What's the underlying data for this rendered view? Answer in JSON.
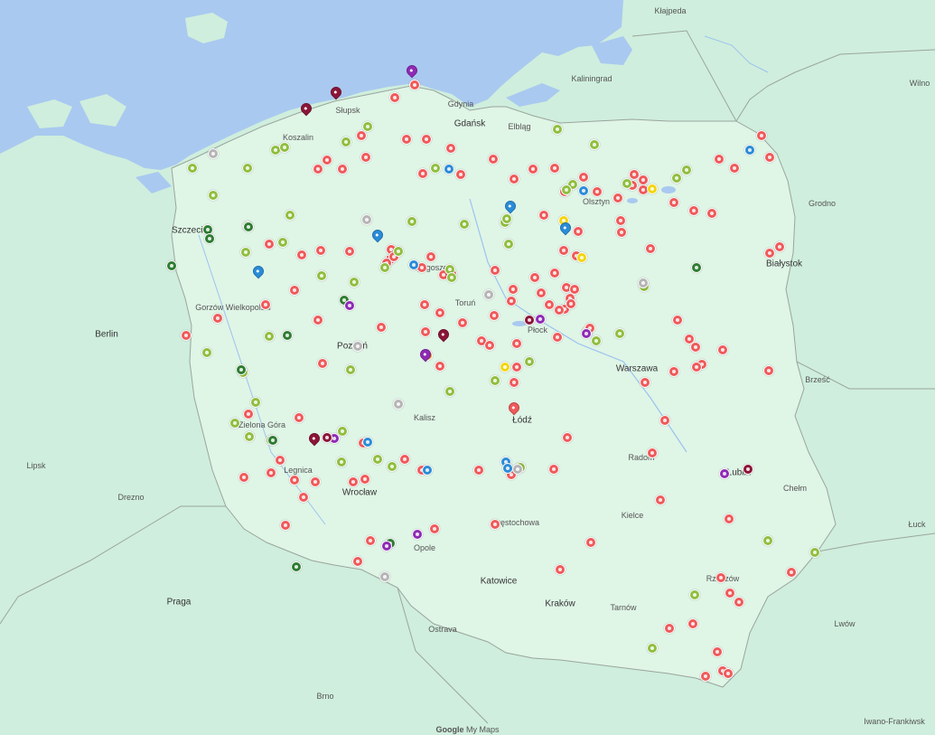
{
  "map": {
    "attribution_brand": "Google",
    "attribution_product": "My Maps",
    "colors": {
      "land": "#cfeedd",
      "land_pl": "#dff5e6",
      "sea": "#a9c9f0",
      "border": "#9aa59c",
      "red": "#ef5a5a",
      "lime": "#8fbf3f",
      "darkgreen": "#2e7d32",
      "blue": "#2a8cd8",
      "gray": "#b5b5b5",
      "yellow": "#f2d60f",
      "purple": "#8e2bb5",
      "maroon": "#8b1538",
      "orange": "#f08c1c"
    }
  },
  "cities": [
    {
      "name": "Gdańsk",
      "big": true
    },
    {
      "name": "Gdynia",
      "big": false
    },
    {
      "name": "Szczecin",
      "big": true
    },
    {
      "name": "Poznań",
      "big": true
    },
    {
      "name": "Warszawa",
      "big": true
    },
    {
      "name": "Łódź",
      "big": true
    },
    {
      "name": "Wrocław",
      "big": true
    },
    {
      "name": "Kraków",
      "big": true
    },
    {
      "name": "Katowice",
      "big": true
    },
    {
      "name": "Lublin",
      "big": true
    },
    {
      "name": "Białystok",
      "big": true
    },
    {
      "name": "Bydgoszcz",
      "big": false
    },
    {
      "name": "Berlin",
      "big": true
    },
    {
      "name": "Praga",
      "big": true
    },
    {
      "name": "Drezno",
      "big": false
    },
    {
      "name": "Lipsk",
      "big": false
    },
    {
      "name": "Wilno",
      "big": false
    },
    {
      "name": "Lwów",
      "big": false
    },
    {
      "name": "Ostrava",
      "big": false
    },
    {
      "name": "Brno",
      "big": false
    },
    {
      "name": "Olsztyn",
      "big": false
    },
    {
      "name": "Kielce",
      "big": false
    },
    {
      "name": "Radom",
      "big": false
    },
    {
      "name": "Rzeszów",
      "big": false
    },
    {
      "name": "Częstochowa",
      "big": false
    },
    {
      "name": "Opole",
      "big": false
    },
    {
      "name": "Toruń",
      "big": false
    },
    {
      "name": "Płock",
      "big": false
    },
    {
      "name": "Kaliningrad",
      "big": false
    },
    {
      "name": "Kłajpeda",
      "big": false
    },
    {
      "name": "Chełm",
      "big": false
    },
    {
      "name": "Brześć",
      "big": false
    },
    {
      "name": "Grodno",
      "big": false
    },
    {
      "name": "Gorzów Wielkopolski",
      "big": false
    },
    {
      "name": "Zielona Góra",
      "big": false
    },
    {
      "name": "Kalisz",
      "big": false
    },
    {
      "name": "Koszalin",
      "big": false
    },
    {
      "name": "Słupsk",
      "big": false
    },
    {
      "name": "Elbląg",
      "big": false
    },
    {
      "name": "Legnica",
      "big": false
    },
    {
      "name": "Tarnów",
      "big": false
    },
    {
      "name": "Iwano-Frankiwsk",
      "big": false
    },
    {
      "name": "Łuck",
      "big": false
    }
  ]
}
